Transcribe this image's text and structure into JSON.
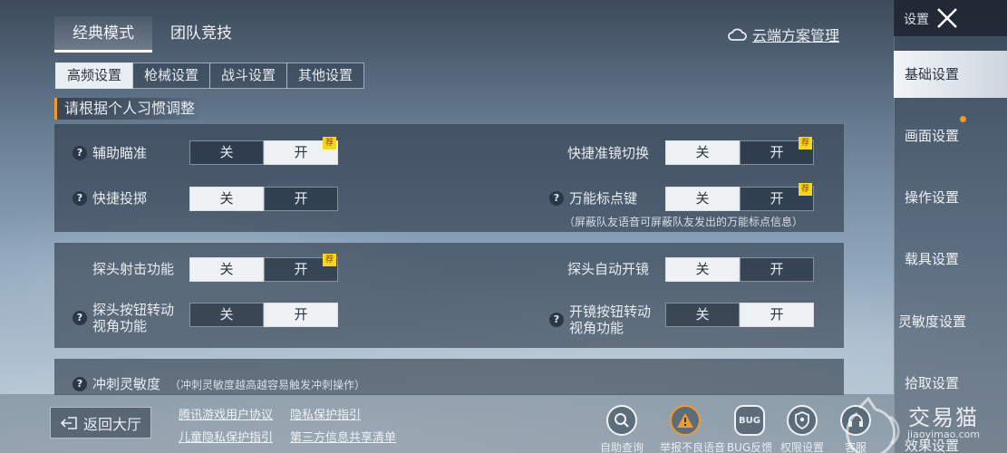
{
  "mode_tabs": [
    "经典模式",
    "团队竞技"
  ],
  "cloud_label": "云端方案管理",
  "sub_tabs": [
    "高频设置",
    "枪械设置",
    "战斗设置",
    "其他设置"
  ],
  "hint": "请根据个人习惯调整",
  "toggle_off": "关",
  "toggle_on": "开",
  "recommend_tag": "荐",
  "panel1": {
    "aim_assist": {
      "label": "辅助瞄准",
      "value": "开"
    },
    "quick_throw": {
      "label": "快捷投掷",
      "value": "关"
    },
    "scope_switch": {
      "label": "快捷准镜切换",
      "value": "关"
    },
    "marker_key": {
      "label": "万能标点键",
      "value": "关",
      "note": "（屏蔽队友语音可屏蔽队友发出的万能标点信息）"
    }
  },
  "panel2": {
    "peek_fire": {
      "label": "探头射击功能",
      "value": "关"
    },
    "peek_btn_rotate": {
      "label1": "探头按钮转动",
      "label2": "视角功能",
      "value": "开"
    },
    "peek_auto_scope": {
      "label": "探头自动开镜",
      "value": "关"
    },
    "scope_btn_rotate": {
      "label1": "开镜按钮转动",
      "label2": "视角功能",
      "value": "开"
    }
  },
  "panel3": {
    "sprint_sens": {
      "label": "冲刺灵敏度",
      "note": "（冲刺灵敏度越高越容易触发冲刺操作）"
    }
  },
  "sidebar": {
    "title": "设置",
    "items": [
      "基础设置",
      "画面设置",
      "操作设置",
      "载具设置",
      "灵敏度设置",
      "拾取设置",
      "效果设置"
    ]
  },
  "bottom": {
    "back_label": "返回大厅",
    "links": [
      "腾讯游戏用户协议",
      "隐私保护指引",
      "儿童隐私保护指引",
      "第三方信息共享清单"
    ],
    "icons": [
      {
        "name": "search-icon",
        "label": "自助查询"
      },
      {
        "name": "report-voice-icon",
        "label": "举报不良语音"
      },
      {
        "name": "bug-icon",
        "label": "BUG反馈"
      },
      {
        "name": "permission-icon",
        "label": "权限设置"
      },
      {
        "name": "service-icon",
        "label": "客服"
      }
    ]
  },
  "watermark": {
    "text": "交易猫",
    "url": "jiaoyimao.com"
  },
  "colors": {
    "accent": "#f29a2e",
    "recommend": "#f7d623"
  }
}
